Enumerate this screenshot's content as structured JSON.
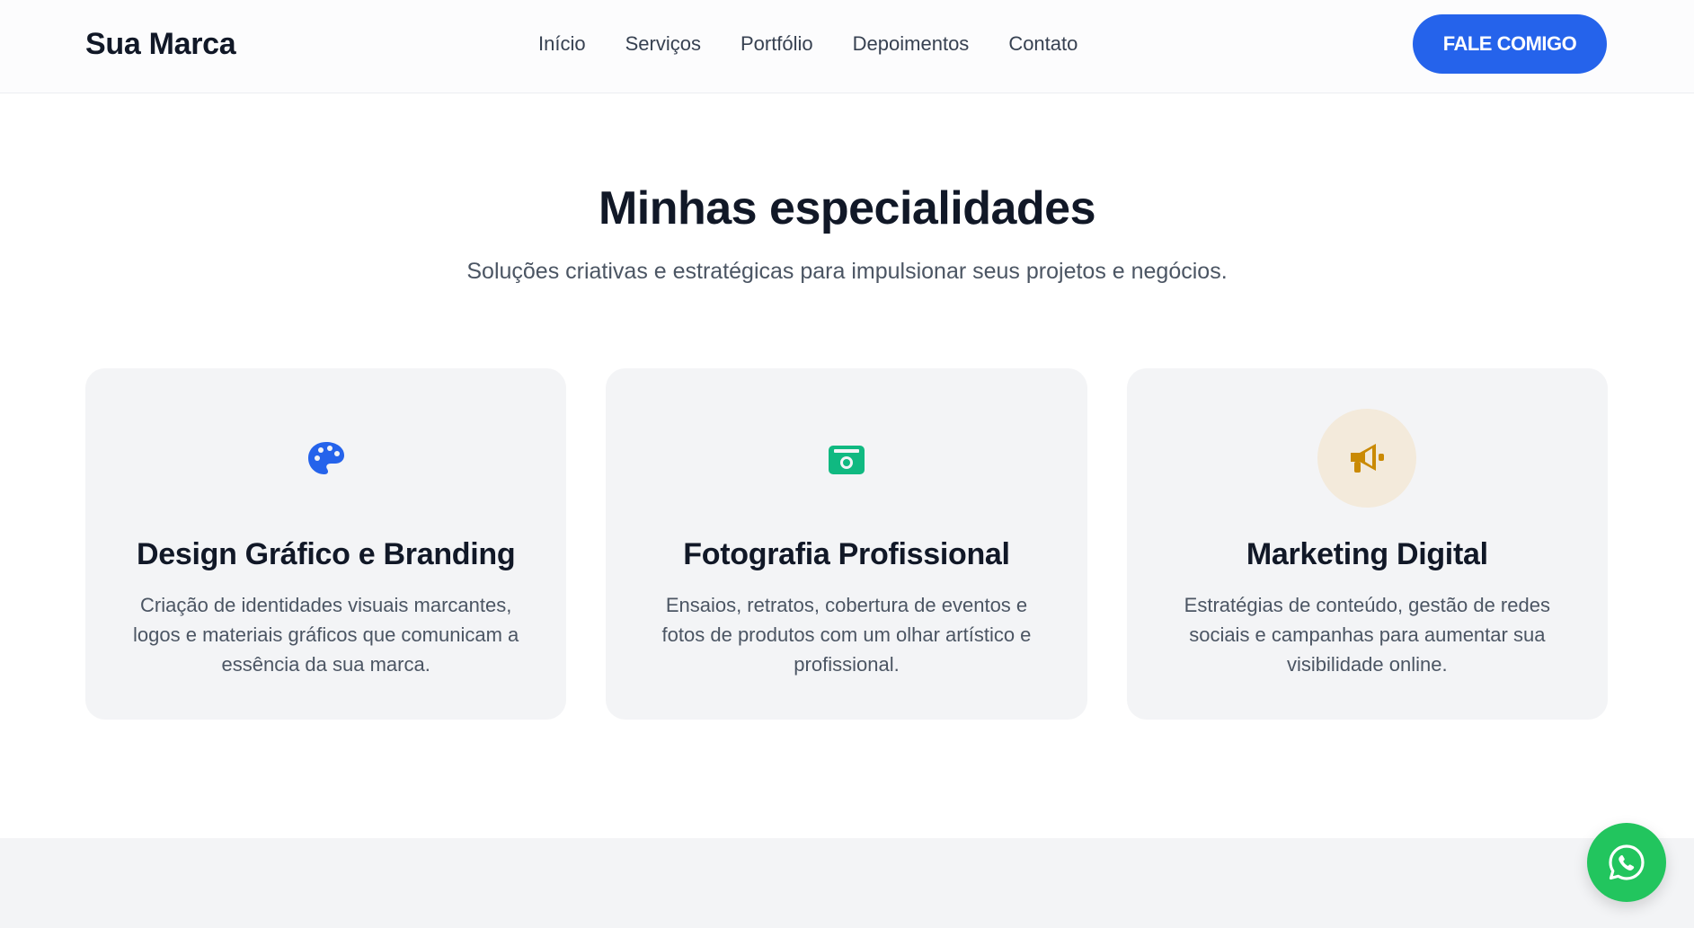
{
  "header": {
    "brand": "Sua Marca",
    "nav": [
      "Início",
      "Serviços",
      "Portfólio",
      "Depoimentos",
      "Contato"
    ],
    "cta_label": "FALE COMIGO"
  },
  "section": {
    "title": "Minhas especialidades",
    "subtitle": "Soluções criativas e estratégicas para impulsionar seus projetos e negócios.",
    "cards": [
      {
        "icon": "palette-icon",
        "icon_color": "#2563eb",
        "title": "Design Gráfico e Branding",
        "description": "Criação de identidades visuais marcantes, logos e materiais gráficos que comunicam a essência da sua marca."
      },
      {
        "icon": "camera-icon",
        "icon_color": "#10b981",
        "title": "Fotografia Profissional",
        "description": "Ensaios, retratos, cobertura de eventos e fotos de produtos com um olhar artístico e profissional."
      },
      {
        "icon": "megaphone-icon",
        "icon_color": "#ca8a04",
        "title": "Marketing Digital",
        "description": "Estratégias de conteúdo, gestão de redes sociais e campanhas para aumentar sua visibilidade online."
      }
    ]
  },
  "floating": {
    "icon": "whatsapp-icon",
    "color": "#22c55e"
  },
  "colors": {
    "accent": "#2563eb",
    "card_background": "#f3f4f6",
    "heading": "#111827",
    "body_text": "#4b5563"
  }
}
